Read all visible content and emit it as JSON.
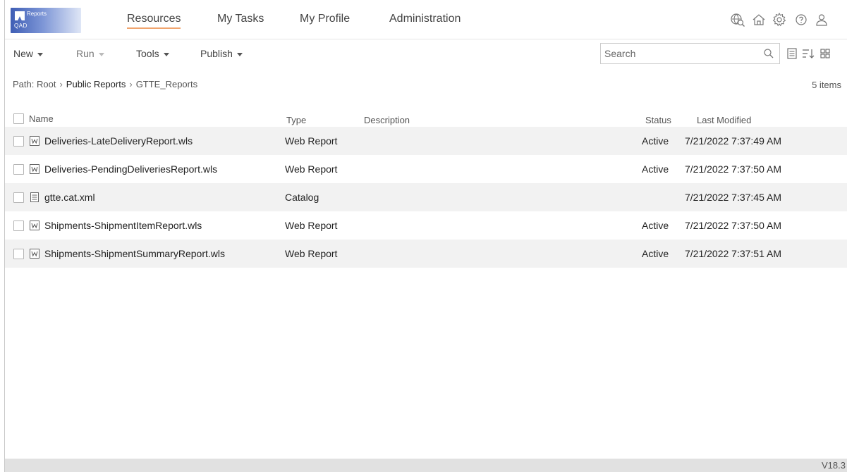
{
  "app": {
    "logo_app": "Reports",
    "logo_brand": "QAD"
  },
  "nav": {
    "tabs": [
      "Resources",
      "My Tasks",
      "My Profile",
      "Administration"
    ]
  },
  "header_icons": [
    "global-search-icon",
    "home-icon",
    "gear-icon",
    "help-icon",
    "user-icon"
  ],
  "toolbar": {
    "new": "New",
    "run": "Run",
    "tools": "Tools",
    "publish": "Publish"
  },
  "search": {
    "placeholder": "Search",
    "value": ""
  },
  "view_icons": [
    "list-view-icon",
    "sort-icon",
    "grid-view-icon"
  ],
  "breadcrumb": {
    "prefix": "Path:",
    "root": "Root",
    "folder": "Public Reports",
    "current": "GTTE_Reports"
  },
  "item_count": "5 items",
  "table": {
    "columns": {
      "name": "Name",
      "type": "Type",
      "description": "Description",
      "status": "Status",
      "modified": "Last Modified"
    },
    "rows": [
      {
        "name": "Deliveries-LateDeliveryReport.wls",
        "icon": "web-report-icon",
        "type": "Web Report",
        "description": "",
        "status": "Active",
        "modified": "7/21/2022 7:37:49 AM"
      },
      {
        "name": "Deliveries-PendingDeliveriesReport.wls",
        "icon": "web-report-icon",
        "type": "Web Report",
        "description": "",
        "status": "Active",
        "modified": "7/21/2022 7:37:50 AM"
      },
      {
        "name": "gtte.cat.xml",
        "icon": "catalog-icon",
        "type": "Catalog",
        "description": "",
        "status": "",
        "modified": "7/21/2022 7:37:45 AM"
      },
      {
        "name": "Shipments-ShipmentItemReport.wls",
        "icon": "web-report-icon",
        "type": "Web Report",
        "description": "",
        "status": "Active",
        "modified": "7/21/2022 7:37:50 AM"
      },
      {
        "name": "Shipments-ShipmentSummaryReport.wls",
        "icon": "web-report-icon",
        "type": "Web Report",
        "description": "",
        "status": "Active",
        "modified": "7/21/2022 7:37:51 AM"
      }
    ]
  },
  "footer": {
    "version": "V18.3"
  },
  "colors": {
    "nav_underline": "#f0a46d",
    "row_shade": "#f2f2f2",
    "footer_bg": "#e1e1e1",
    "logo_blue": "#3f5eb5"
  }
}
